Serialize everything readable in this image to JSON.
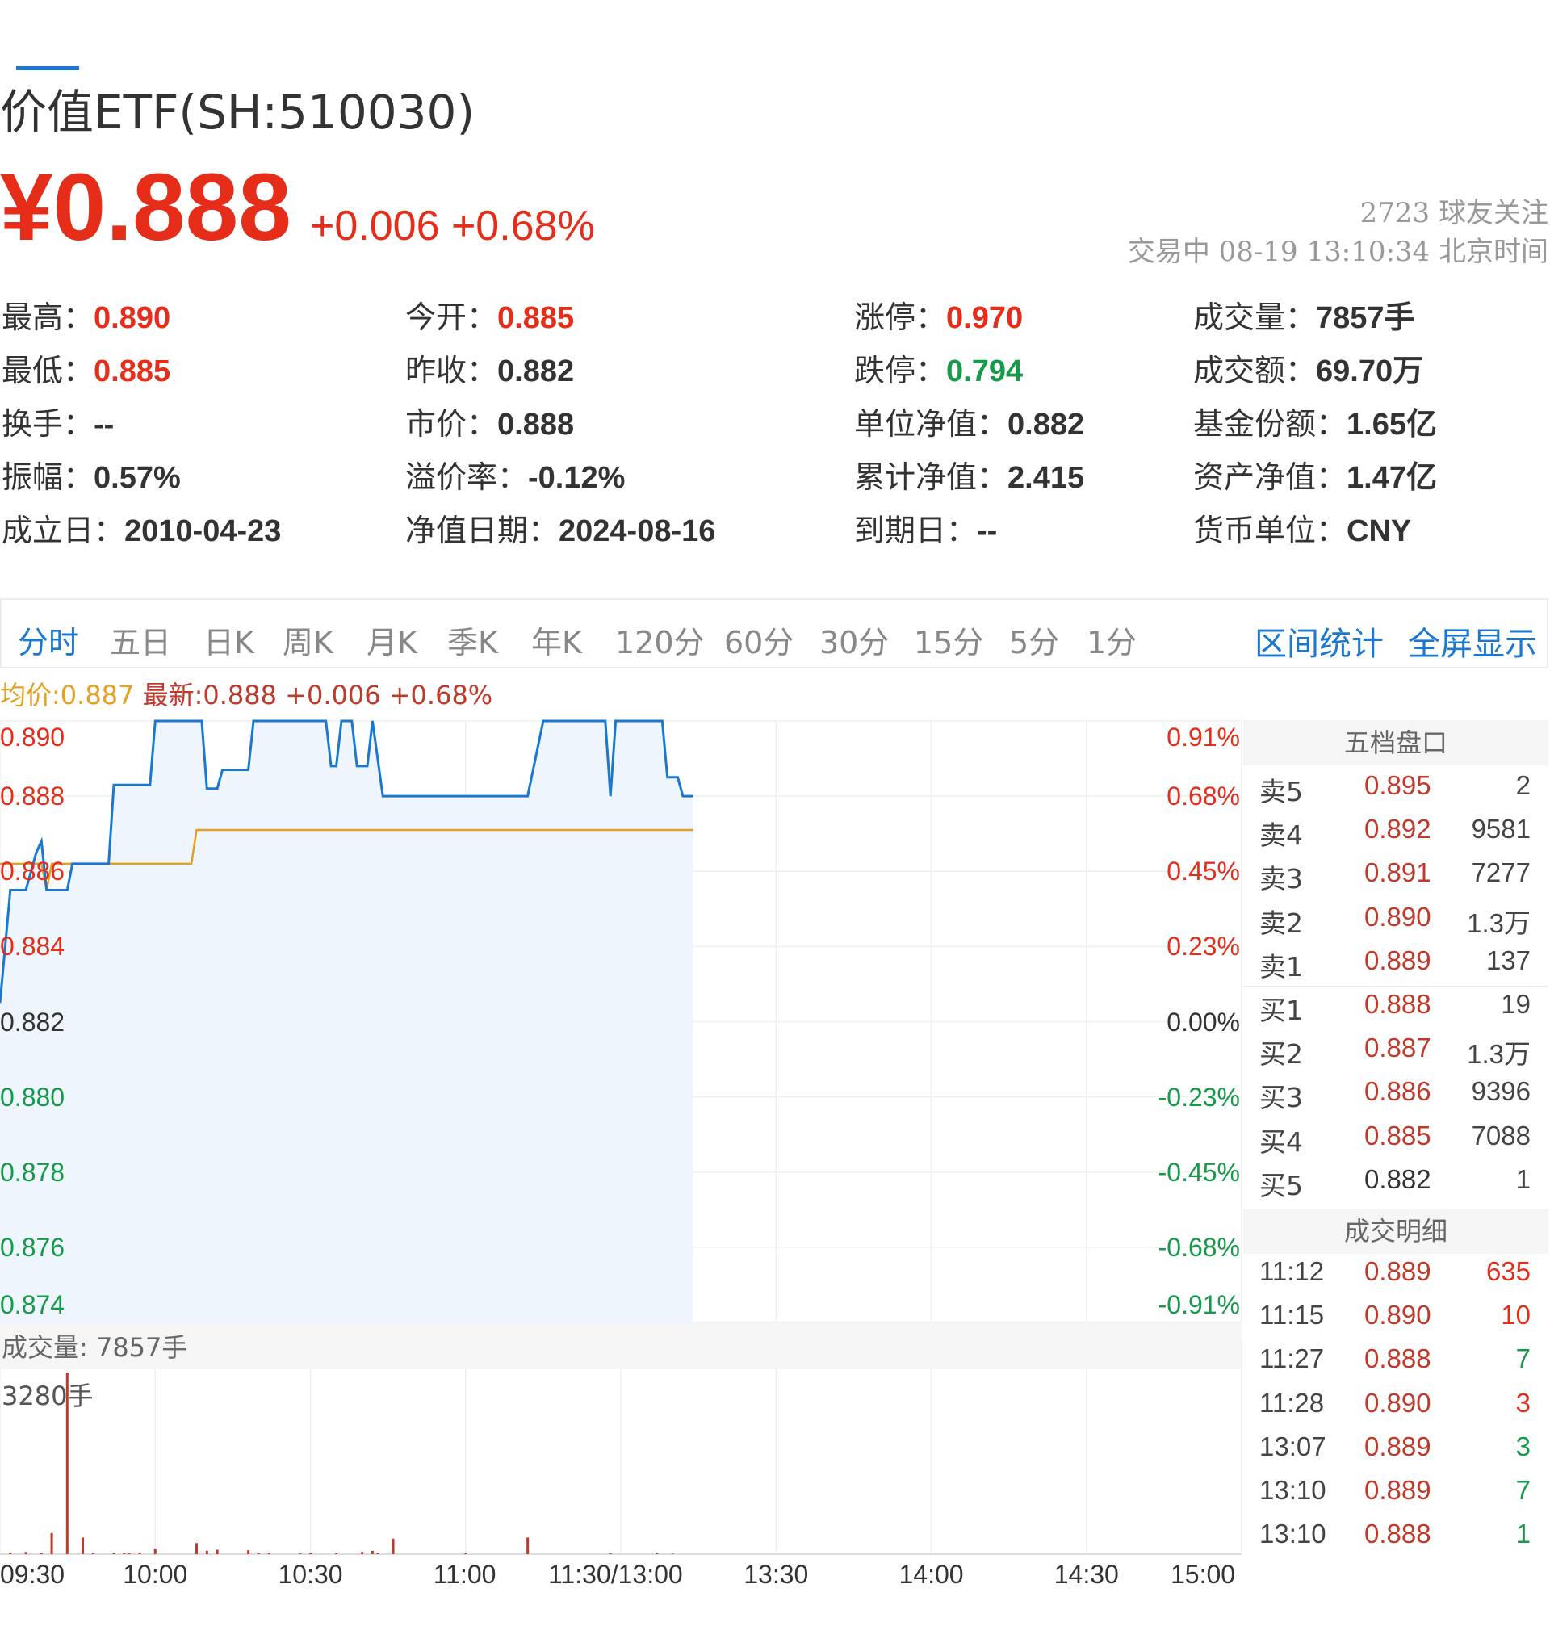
{
  "header": {
    "title": "价值ETF(SH:510030)",
    "price": "¥0.888",
    "change": "+0.006 +0.68%",
    "followers": "2723 球友关注",
    "status": "交易中 08-19 13:10:34 北京时间"
  },
  "quote": [
    {
      "k": "最高：",
      "v": "0.890",
      "c": "up"
    },
    {
      "k": "今开：",
      "v": "0.885",
      "c": "up"
    },
    {
      "k": "涨停：",
      "v": "0.970",
      "c": "up"
    },
    {
      "k": "成交量：",
      "v": "7857手",
      "c": "flat"
    },
    {
      "k": "最低：",
      "v": "0.885",
      "c": "up"
    },
    {
      "k": "昨收：",
      "v": "0.882",
      "c": "flat"
    },
    {
      "k": "跌停：",
      "v": "0.794",
      "c": "down"
    },
    {
      "k": "成交额：",
      "v": "69.70万",
      "c": "flat"
    },
    {
      "k": "换手：",
      "v": "--",
      "c": "flat"
    },
    {
      "k": "市价：",
      "v": "0.888",
      "c": "flat"
    },
    {
      "k": "单位净值：",
      "v": "0.882",
      "c": "flat"
    },
    {
      "k": "基金份额：",
      "v": "1.65亿",
      "c": "flat"
    },
    {
      "k": "振幅：",
      "v": "0.57%",
      "c": "flat"
    },
    {
      "k": "溢价率：",
      "v": "-0.12%",
      "c": "flat"
    },
    {
      "k": "累计净值：",
      "v": "2.415",
      "c": "flat"
    },
    {
      "k": "资产净值：",
      "v": "1.47亿",
      "c": "flat"
    },
    {
      "k": "成立日：",
      "v": "2010-04-23",
      "c": "flat"
    },
    {
      "k": "净值日期：",
      "v": "2024-08-16",
      "c": "flat"
    },
    {
      "k": "到期日：",
      "v": "--",
      "c": "flat"
    },
    {
      "k": "货币单位：",
      "v": "CNY",
      "c": "flat"
    }
  ],
  "tabs": [
    "分时",
    "五日",
    "日K",
    "周K",
    "月K",
    "季K",
    "年K",
    "120分",
    "60分",
    "30分",
    "15分",
    "5分",
    "1分"
  ],
  "active_tab": "分时",
  "tab_actions": [
    "区间统计",
    "全屏显示"
  ],
  "legend": {
    "avg": "均价:0.887",
    "last": "最新:0.888 +0.006 +0.68%"
  },
  "volume": {
    "label": "成交量: 7857手",
    "max_label": "3280手"
  },
  "order_book": {
    "title": "五档盘口",
    "rows": [
      {
        "side": "卖5",
        "price": "0.895",
        "qty": "2"
      },
      {
        "side": "卖4",
        "price": "0.892",
        "qty": "9581"
      },
      {
        "side": "卖3",
        "price": "0.891",
        "qty": "7277"
      },
      {
        "side": "卖2",
        "price": "0.890",
        "qty": "1.3万"
      },
      {
        "side": "卖1",
        "price": "0.889",
        "qty": "137"
      },
      {
        "side": "买1",
        "price": "0.888",
        "qty": "19"
      },
      {
        "side": "买2",
        "price": "0.887",
        "qty": "1.3万"
      },
      {
        "side": "买3",
        "price": "0.886",
        "qty": "9396"
      },
      {
        "side": "买4",
        "price": "0.885",
        "qty": "7088"
      },
      {
        "side": "买5",
        "price": "0.882",
        "qty": "1"
      }
    ],
    "trades_title": "成交明细",
    "trades": [
      {
        "time": "11:12",
        "price": "0.889",
        "qty": "635",
        "dir": "up"
      },
      {
        "time": "11:15",
        "price": "0.890",
        "qty": "10",
        "dir": "up"
      },
      {
        "time": "11:27",
        "price": "0.888",
        "qty": "7",
        "dir": "down"
      },
      {
        "time": "11:28",
        "price": "0.890",
        "qty": "3",
        "dir": "up"
      },
      {
        "time": "13:07",
        "price": "0.889",
        "qty": "3",
        "dir": "down"
      },
      {
        "time": "13:10",
        "price": "0.889",
        "qty": "7",
        "dir": "down"
      },
      {
        "time": "13:10",
        "price": "0.888",
        "qty": "1",
        "dir": "down"
      }
    ]
  },
  "colors": {
    "up": "#e52d1a",
    "down": "#17994a",
    "price_line": "#1a78d1",
    "avg_line": "#e6a020",
    "fill": "#eef5fd"
  },
  "chart_data": {
    "type": "line",
    "title": "",
    "y_ticks": [
      "0.890",
      "0.888",
      "0.886",
      "0.884",
      "0.882",
      "0.880",
      "0.878",
      "0.876",
      "0.874"
    ],
    "pct_ticks": [
      "0.91%",
      "0.68%",
      "0.45%",
      "0.23%",
      "0.00%",
      "-0.23%",
      "-0.45%",
      "-0.68%",
      "-0.91%"
    ],
    "x_ticks": [
      "09:30",
      "10:00",
      "10:30",
      "11:00",
      "11:30/13:00",
      "13:30",
      "14:00",
      "14:30",
      "15:00"
    ],
    "ylim": [
      0.874,
      0.89
    ],
    "prev_close": 0.882,
    "series": [
      {
        "name": "最新",
        "color": "#1a78d1",
        "points": [
          [
            0,
            0.8825
          ],
          [
            2,
            0.8855
          ],
          [
            5,
            0.8855
          ],
          [
            7,
            0.8865
          ],
          [
            8,
            0.8868
          ],
          [
            9,
            0.8855
          ],
          [
            13,
            0.8855
          ],
          [
            14,
            0.8862
          ],
          [
            21,
            0.8862
          ],
          [
            22,
            0.8883
          ],
          [
            29,
            0.8883
          ],
          [
            30,
            0.89
          ],
          [
            39,
            0.89
          ],
          [
            40,
            0.8882
          ],
          [
            42,
            0.8882
          ],
          [
            43,
            0.8887
          ],
          [
            48,
            0.8887
          ],
          [
            49,
            0.89
          ],
          [
            63,
            0.89
          ],
          [
            64,
            0.8888
          ],
          [
            65,
            0.8888
          ],
          [
            66,
            0.89
          ],
          [
            68,
            0.89
          ],
          [
            69,
            0.8888
          ],
          [
            71,
            0.8888
          ],
          [
            72,
            0.89
          ],
          [
            74,
            0.888
          ],
          [
            102,
            0.888
          ],
          [
            105,
            0.89
          ],
          [
            117,
            0.89
          ],
          [
            118,
            0.888
          ],
          [
            119,
            0.89
          ],
          [
            128,
            0.89
          ],
          [
            129,
            0.8885
          ],
          [
            131,
            0.8885
          ],
          [
            132,
            0.888
          ],
          [
            134,
            0.888
          ]
        ]
      },
      {
        "name": "均价",
        "color": "#e6a020",
        "points": [
          [
            0,
            0.8862
          ],
          [
            8,
            0.8862
          ],
          [
            9,
            0.8855
          ],
          [
            10,
            0.8862
          ],
          [
            37,
            0.8862
          ],
          [
            38,
            0.8871
          ],
          [
            134,
            0.8871
          ]
        ]
      }
    ],
    "volume": {
      "unit": "手",
      "ymax": 3280,
      "bars": [
        [
          2,
          30
        ],
        [
          5,
          40
        ],
        [
          8,
          25
        ],
        [
          10,
          380
        ],
        [
          13,
          3280
        ],
        [
          16,
          300
        ],
        [
          18,
          20
        ],
        [
          22,
          15
        ],
        [
          24,
          25
        ],
        [
          25,
          20
        ],
        [
          27,
          30
        ],
        [
          30,
          100
        ],
        [
          38,
          200
        ],
        [
          40,
          60
        ],
        [
          42,
          80
        ],
        [
          48,
          70
        ],
        [
          50,
          15
        ],
        [
          52,
          20
        ],
        [
          58,
          15
        ],
        [
          60,
          20
        ],
        [
          65,
          20
        ],
        [
          70,
          40
        ],
        [
          72,
          60
        ],
        [
          73,
          20
        ],
        [
          76,
          280
        ],
        [
          90,
          15
        ],
        [
          102,
          300
        ],
        [
          118,
          15
        ],
        [
          127,
          15
        ],
        [
          130,
          10
        ]
      ]
    }
  }
}
